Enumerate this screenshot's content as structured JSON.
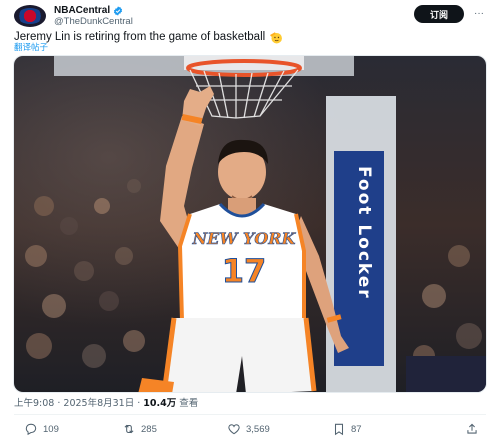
{
  "account": {
    "display_name": "NBACentral",
    "handle": "@TheDunkCentral",
    "verified": true
  },
  "follow_label": "订阅",
  "more_label": "···",
  "tweet": {
    "text": "Jeremy Lin is retiring from the game of basketball",
    "emoji": "saluting-face",
    "translate_label": "翻译帖子"
  },
  "media": {
    "jersey_team": "NEW YORK",
    "jersey_number": "17",
    "sign_text": "Foot Locker"
  },
  "meta": {
    "time": "上午9:08",
    "separator": " · ",
    "date": "2025年8月31日",
    "views_count": "10.4万",
    "views_label": "查看"
  },
  "actions": {
    "replies": "109",
    "reposts": "285",
    "likes": "3,569",
    "bookmarks": "87"
  },
  "colors": {
    "follow_bg": "#0f1419",
    "link": "#1d9bf0",
    "verified": "#1d9bf0",
    "muted": "#536471",
    "knicks_orange": "#f58426",
    "knicks_blue": "#006bb6"
  }
}
